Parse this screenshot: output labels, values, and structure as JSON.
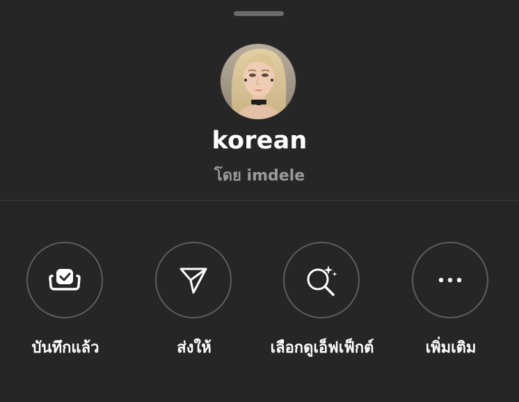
{
  "sheet": {
    "title": "korean",
    "byline": "โดย imdele"
  },
  "avatar": {
    "alt": "profile avatar"
  },
  "actions": [
    {
      "label": "บันทึกแล้ว",
      "icon": "saved-check-icon"
    },
    {
      "label": "ส่งให้",
      "icon": "send-icon"
    },
    {
      "label": "เลือกดูเอ็ฟเฟ็กต์",
      "icon": "browse-effects-icon"
    },
    {
      "label": "เพิ่มเติม",
      "icon": "more-icon"
    }
  ],
  "colors": {
    "background": "#262626",
    "text": "#ffffff",
    "muted": "#9a9a9a",
    "circle_border": "#5e5e5e",
    "divider": "#3a3a3a"
  }
}
